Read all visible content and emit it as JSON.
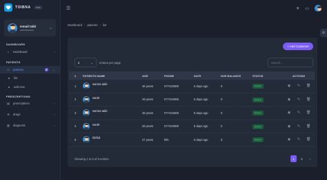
{
  "brand": {
    "name": "TOIBNA",
    "tag": "beta"
  },
  "profile": {
    "name": "Ismail taibi",
    "role": "administrator"
  },
  "sidebar": {
    "sections": [
      {
        "label": "DASHBOARD"
      },
      {
        "label": "PATIENTS"
      },
      {
        "label": "PRESCRIPTIONS"
      }
    ],
    "items": [
      {
        "label": "Dashboard"
      },
      {
        "label": "patients",
        "badge": "2"
      },
      {
        "label": "list"
      },
      {
        "label": "add new"
      },
      {
        "label": "prescriptions"
      },
      {
        "label": "drugs"
      },
      {
        "label": "diagnosis"
      }
    ]
  },
  "breadcrumb": [
    "Dashboard",
    "patients",
    "list"
  ],
  "card": {
    "add_button": "+ Add Customer",
    "entries_value": "5",
    "entries_label": "entries per page",
    "search_placeholder": "Search...",
    "columns": [
      "#",
      "PATIENTS NAME",
      "AGE",
      "PHONE",
      "DATE",
      "DUE BALANCE",
      "STATUS",
      "ACTIONS"
    ],
    "rows": [
      {
        "num": "1",
        "name": "samira taibi",
        "age": "36 years",
        "phone": "077423369",
        "date": "5 days ago",
        "due": "0",
        "status": "Active"
      },
      {
        "num": "2",
        "name": "sarah",
        "age": "28 years",
        "phone": "077423369",
        "date": "5 days ago",
        "due": "0",
        "status": "Active"
      },
      {
        "num": "3",
        "name": "samira taibi",
        "age": "36 years",
        "phone": "077423369",
        "date": "5 days ago",
        "due": "0",
        "status": "Active"
      },
      {
        "num": "4",
        "name": "sarah",
        "age": "28 years",
        "phone": "077423369",
        "date": "5 days ago",
        "due": "0",
        "status": "Active"
      },
      {
        "num": "5",
        "name": "fdsfsd",
        "age": "27 years",
        "phone": "fsfs",
        "date": "5 days ago",
        "due": "0",
        "status": "Active"
      }
    ],
    "footer_info": "Showing 1 to 5 of 9 entries",
    "pages": [
      "1",
      "2"
    ],
    "next": "›"
  },
  "colors": {
    "accent": "#7b5cf5",
    "status_active": "#4fd08a",
    "background": "#1a1f2b"
  }
}
